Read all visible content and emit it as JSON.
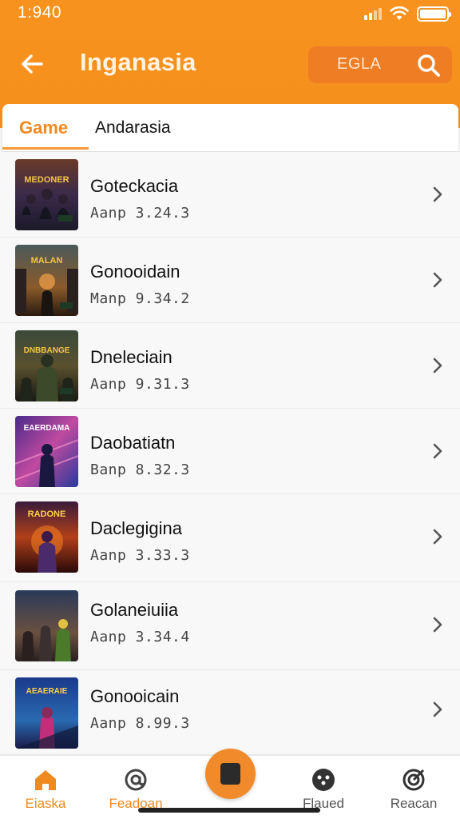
{
  "status_bar": {
    "time": "1:940"
  },
  "header": {
    "title": "Inganasia",
    "search_text": "EGLA",
    "accent": "#f7921e"
  },
  "tabs": [
    {
      "label": "Game",
      "active": true
    },
    {
      "label": "Andarasia",
      "active": false
    }
  ],
  "items": [
    {
      "title": "Goteckacia",
      "subtitle": "Aanp 3.24.3",
      "thumb_label": "MEDONER"
    },
    {
      "title": "Gonooidain",
      "subtitle": "Manp 9.34.2",
      "thumb_label": "MALAN"
    },
    {
      "title": "Dneleciain",
      "subtitle": "Aanp 9.31.3",
      "thumb_label": "DNBBANGE"
    },
    {
      "title": "Daobatiatn",
      "subtitle": "Banp 8.32.3",
      "thumb_label": "EAERDAMA"
    },
    {
      "title": "Daclegigina",
      "subtitle": "Aanp 3.33.3",
      "thumb_label": "RADONE"
    },
    {
      "title": "Golaneiuiia",
      "subtitle": "Aanp 3.34.4",
      "thumb_label": ""
    },
    {
      "title": "Gonooicain",
      "subtitle": "Aanp 8.99.3",
      "thumb_label": "AEAERAIE"
    }
  ],
  "bottom_nav": [
    {
      "label": "Eiaska",
      "icon": "home-icon",
      "active": true
    },
    {
      "label": "Feadoan",
      "icon": "at-icon",
      "active": false
    },
    {
      "label": "Flaued",
      "icon": "game-icon",
      "active": false
    },
    {
      "label": "Reacan",
      "icon": "target-icon",
      "active": false
    }
  ],
  "colors": {
    "accent": "#f0891e",
    "header": "#f7921e"
  }
}
